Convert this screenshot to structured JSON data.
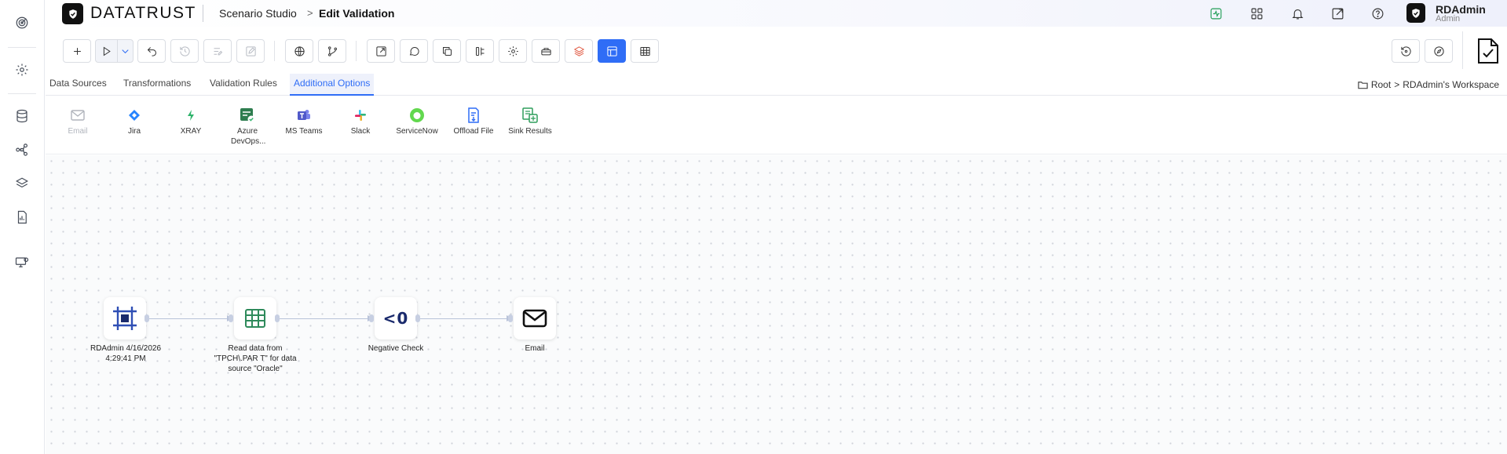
{
  "header": {
    "brand_strong": "DATA",
    "brand_light": "TRUST",
    "breadcrumb_studio": "Scenario Studio",
    "breadcrumb_sep": ">",
    "breadcrumb_page": "Edit Validation",
    "user_name": "RDAdmin",
    "user_role": "Admin"
  },
  "tabs": [
    {
      "label": "Data Sources"
    },
    {
      "label": "Transformations"
    },
    {
      "label": "Validation Rules"
    },
    {
      "label": "Additional Options"
    }
  ],
  "workspace": {
    "root": "Root",
    "sep": ">",
    "name": "RDAdmin's Workspace"
  },
  "palette": [
    {
      "label": "Email",
      "disabled": true
    },
    {
      "label": "Jira"
    },
    {
      "label": "XRAY"
    },
    {
      "label": "Azure DevOps..."
    },
    {
      "label": "MS Teams"
    },
    {
      "label": "Slack"
    },
    {
      "label": "ServiceNow"
    },
    {
      "label": "Offload File"
    },
    {
      "label": "Sink Results"
    }
  ],
  "nodes": [
    {
      "label": "RDAdmin 4/16/2026 4:29:41 PM"
    },
    {
      "label": "Read data from \"TPCH\\.PAR T\" for data source \"Oracle\""
    },
    {
      "label": "Negative Check",
      "glyph": "<0"
    },
    {
      "label": "Email"
    }
  ],
  "colors": {
    "accent": "#2f6df6",
    "tab_active_bg": "#eef1fb"
  }
}
